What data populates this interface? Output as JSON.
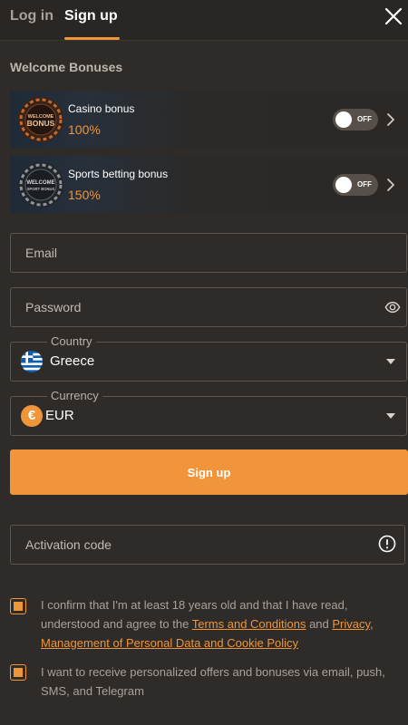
{
  "tabs": {
    "login_label": "Log in",
    "signup_label": "Sign up"
  },
  "bonuses": {
    "title": "Welcome Bonuses",
    "items": [
      {
        "name": "Casino bonus",
        "percent": "100%",
        "toggle_label": "OFF",
        "badge_line1": "WELCOME",
        "badge_line2": "BONUS",
        "badge_icon": "casino-badge-icon"
      },
      {
        "name": "Sports betting bonus",
        "percent": "150%",
        "toggle_label": "OFF",
        "badge_line1": "WELCOME",
        "badge_line2": "SPORT BONUS",
        "badge_icon": "sports-badge-icon"
      }
    ]
  },
  "form": {
    "email_placeholder": "Email",
    "password_placeholder": "Password",
    "country_label": "Country",
    "country_value": "Greece",
    "currency_label": "Currency",
    "currency_value": "EUR",
    "currency_symbol": "€",
    "signup_button": "Sign up",
    "activation_placeholder": "Activation code"
  },
  "consent": {
    "age_text_before": "I confirm that I'm at least 18 years old and that I have read, understood and agree to the ",
    "terms_link": "Terms and Conditions",
    "age_text_middle": " and ",
    "privacy_link": "Privacy, Management of Personal Data and Cookie Policy",
    "offers_text": "I want to receive personalized offers and bonuses via email, push, SMS, and Telegram"
  },
  "colors": {
    "background": "#2e2b28",
    "accent": "#f0953a",
    "muted_text": "#a8a29b"
  }
}
